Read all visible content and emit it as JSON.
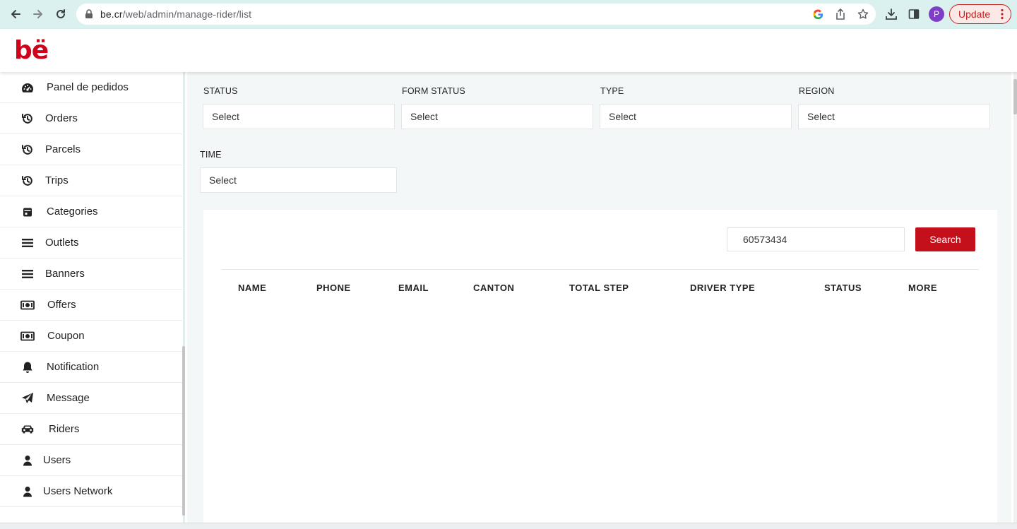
{
  "browser": {
    "url_host": "be.cr",
    "url_path": "/web/admin/manage-rider/list",
    "profile_initial": "P",
    "update_label": "Update",
    "accent": "#c5221f"
  },
  "app": {
    "logo_text": "bë",
    "brand_color": "#d0021b"
  },
  "sidebar": {
    "items": [
      {
        "label": "Panel de pedidos",
        "icon": "dashboard-icon"
      },
      {
        "label": "Orders",
        "icon": "history-icon"
      },
      {
        "label": "Parcels",
        "icon": "history-icon"
      },
      {
        "label": "Trips",
        "icon": "history-icon"
      },
      {
        "label": "Categories",
        "icon": "calendar-icon"
      },
      {
        "label": "Outlets",
        "icon": "menu-icon"
      },
      {
        "label": "Banners",
        "icon": "menu-icon"
      },
      {
        "label": "Offers",
        "icon": "money-icon"
      },
      {
        "label": "Coupon",
        "icon": "money-icon"
      },
      {
        "label": "Notification",
        "icon": "bell-icon"
      },
      {
        "label": "Message",
        "icon": "send-icon"
      },
      {
        "label": "Riders",
        "icon": "car-icon"
      },
      {
        "label": "Users",
        "icon": "user-icon"
      },
      {
        "label": "Users Network",
        "icon": "user-icon"
      }
    ]
  },
  "filters": {
    "status": {
      "label": "STATUS",
      "value": "Select"
    },
    "form_status": {
      "label": "FORM STATUS",
      "value": "Select"
    },
    "type": {
      "label": "TYPE",
      "value": "Select"
    },
    "region": {
      "label": "REGION",
      "value": "Select"
    },
    "time": {
      "label": "TIME",
      "value": "Select"
    }
  },
  "search": {
    "value": "60573434",
    "button_label": "Search",
    "button_color": "#c3101b"
  },
  "table": {
    "columns": [
      "NAME",
      "PHONE",
      "EMAIL",
      "CANTON",
      "TOTAL STEP",
      "DRIVER TYPE",
      "STATUS",
      "MORE"
    ],
    "rows": []
  }
}
